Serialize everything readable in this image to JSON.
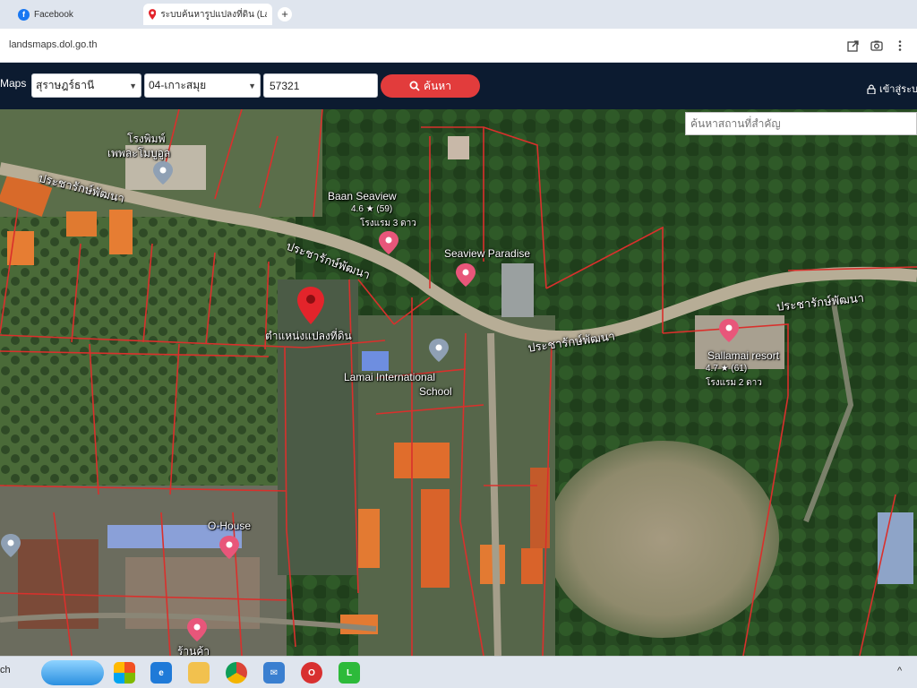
{
  "browser": {
    "tabs": [
      {
        "label": "Facebook",
        "icon": "facebook-icon"
      },
      {
        "label": "ระบบค้นหารูปแปลงที่ดิน (Lan",
        "icon": "map-pin-icon"
      }
    ],
    "new_tab": "+",
    "url": "landsmaps.dol.go.th"
  },
  "header": {
    "brand": "Maps",
    "province": "สุราษฎร์ธานี",
    "district": "04-เกาะสมุย",
    "parcel_number": "57321",
    "search_label": "ค้นหา",
    "login_label": "เข้าสู่ระบ",
    "accent_color": "#e23c3c"
  },
  "map": {
    "landmark_search_placeholder": "ค้นหาสถานที่สำคัญ",
    "parcel_marker_label": "ตำแหน่งแปลงที่ดิน",
    "places": {
      "top_left": "โรงพิมพ์",
      "top_left_sub": "เพพละโมบูอูล",
      "baan_seaview": "Baan Seaview",
      "baan_seaview_rating": "4.6 ★ (59)",
      "baan_seaview_type": "โรงแรม 3 ดาว",
      "seaview_paradise": "Seaview Paradise",
      "lamai_school_1": "Lamai International",
      "lamai_school_2": "School",
      "sallamai": "Sallamai resort",
      "sallamai_rating": "4.7 ★ (61)",
      "sallamai_type": "โรงแรม 2 ดาว",
      "o_house": "O-House",
      "bottom_left": "ร้านค้า"
    },
    "roads": {
      "road_1": "ประชารักษ์พัฒนา",
      "road_2": "ประชารักษ์พัฒนา",
      "road_3": "ประชารักษ์พัฒนา",
      "road_4": "ประชารักษ์พัฒนา"
    },
    "colors": {
      "parcel_border": "#d9302c",
      "marker": "#e3242b",
      "poi_pink": "#e8567a"
    }
  },
  "taskbar": {
    "search_label": "ch"
  }
}
